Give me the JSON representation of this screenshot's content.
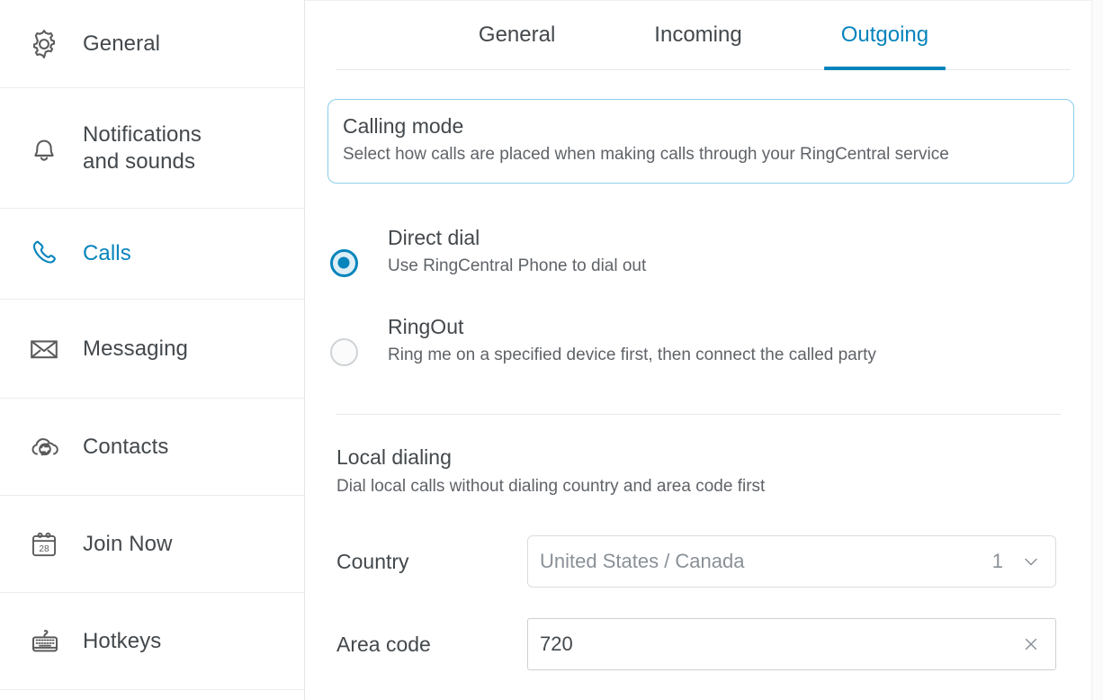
{
  "accent_color": "#0684bc",
  "text_color": "#43484c",
  "muted_text_color": "#5f6368",
  "placeholder_color": "#8a9097",
  "info_box_border_color": "#8ccdec",
  "sidebar": {
    "items": [
      {
        "id": "general",
        "label": "General",
        "icon": "gear-icon",
        "active": false
      },
      {
        "id": "notifications",
        "label": "Notifications\nand sounds",
        "label_line1": "Notifications",
        "label_line2": "and sounds",
        "icon": "bell-icon",
        "active": false
      },
      {
        "id": "calls",
        "label": "Calls",
        "icon": "phone-icon",
        "active": true
      },
      {
        "id": "messaging",
        "label": "Messaging",
        "icon": "envelope-icon",
        "active": false
      },
      {
        "id": "contacts",
        "label": "Contacts",
        "icon": "cloud-sync-icon",
        "active": false
      },
      {
        "id": "join-now",
        "label": "Join Now",
        "icon": "calendar-icon",
        "icon_day": "28",
        "active": false
      },
      {
        "id": "hotkeys",
        "label": "Hotkeys",
        "icon": "keyboard-icon",
        "active": false
      }
    ]
  },
  "main": {
    "tabs": [
      {
        "id": "general",
        "label": "General",
        "active": false
      },
      {
        "id": "incoming",
        "label": "Incoming",
        "active": false
      },
      {
        "id": "outgoing",
        "label": "Outgoing",
        "active": true
      }
    ],
    "calling_mode": {
      "title": "Calling mode",
      "description": "Select how calls are placed when making  calls through your RingCentral service"
    },
    "calling_options": [
      {
        "id": "direct-dial",
        "title": "Direct dial",
        "description": "Use RingCentral Phone to dial out",
        "selected": true
      },
      {
        "id": "ringout",
        "title": "RingOut",
        "description": "Ring me on a specified device first, then connect the called party",
        "selected": false
      }
    ],
    "local_dialing": {
      "title": "Local dialing",
      "description": "Dial local calls without dialing country and area code first",
      "country": {
        "label": "Country",
        "value": "United States / Canada",
        "dial_code": "1",
        "chevron_icon": "chevron-down-icon"
      },
      "area_code": {
        "label": "Area code",
        "value": "720",
        "placeholder": "Area code",
        "clear_icon": "close-icon"
      }
    }
  }
}
